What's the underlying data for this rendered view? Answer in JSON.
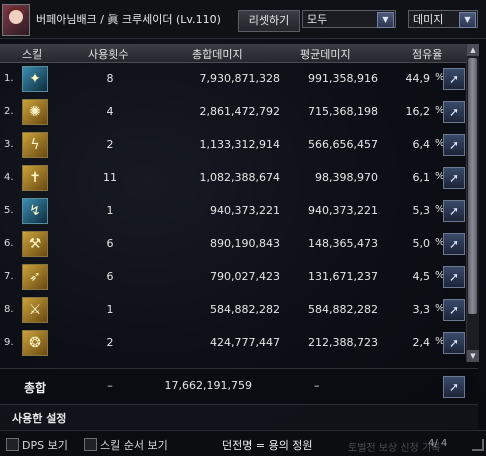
{
  "header": {
    "char_name": "버페아님배크 / 眞 크루세이더 (Lv.110)",
    "reset_label": "리셋하기",
    "filter_value": "모두",
    "metric_value": "데미지"
  },
  "columns": {
    "skill": "스킬",
    "uses": "사용횟수",
    "total": "총합데미지",
    "avg": "평균데미지",
    "share": "점유율"
  },
  "rows": [
    {
      "rank": "1.",
      "icon": "holy-light-skill-icon",
      "glyph": "✦",
      "color": "blue",
      "uses": "8",
      "total": "7,930,871,328",
      "avg": "991,358,916",
      "share": "44,9"
    },
    {
      "rank": "2.",
      "icon": "holy-wheel-skill-icon",
      "glyph": "✺",
      "color": "gold",
      "uses": "4",
      "total": "2,861,472,792",
      "avg": "715,368,198",
      "share": "16,2"
    },
    {
      "rank": "3.",
      "icon": "thunder-strike-skill-icon",
      "glyph": "ϟ",
      "color": "gold",
      "uses": "2",
      "total": "1,133,312,914",
      "avg": "566,656,457",
      "share": "6,4"
    },
    {
      "rank": "4.",
      "icon": "cross-blessing-skill-icon",
      "glyph": "✝",
      "color": "gold",
      "uses": "11",
      "total": "1,082,388,674",
      "avg": "98,398,970",
      "share": "6,1"
    },
    {
      "rank": "5.",
      "icon": "lightning-bolt-skill-icon",
      "glyph": "↯",
      "color": "blue",
      "uses": "1",
      "total": "940,373,221",
      "avg": "940,373,221",
      "share": "5,3"
    },
    {
      "rank": "6.",
      "icon": "radiant-hammer-skill-icon",
      "glyph": "⚒",
      "color": "gold",
      "uses": "6",
      "total": "890,190,843",
      "avg": "148,365,473",
      "share": "5,0"
    },
    {
      "rank": "7.",
      "icon": "divine-arrow-skill-icon",
      "glyph": "➶",
      "color": "gold",
      "uses": "6",
      "total": "790,027,423",
      "avg": "131,671,237",
      "share": "4,5"
    },
    {
      "rank": "8.",
      "icon": "sacred-sword-skill-icon",
      "glyph": "⚔",
      "color": "gold",
      "uses": "1",
      "total": "584,882,282",
      "avg": "584,882,282",
      "share": "3,3"
    },
    {
      "rank": "9.",
      "icon": "spiral-light-skill-icon",
      "glyph": "❂",
      "color": "gold",
      "uses": "2",
      "total": "424,777,447",
      "avg": "212,388,723",
      "share": "2,4"
    }
  ],
  "percent_sign": "%",
  "total_row": {
    "label": "총합",
    "uses": "–",
    "total": "17,662,191,759",
    "avg": "–"
  },
  "settings_label": "사용한 설정",
  "bottom": {
    "dps_label": "DPS 보기",
    "skill_order_label": "스킬 순서 보기",
    "title_label": "던전명 = 용의 정원",
    "page": "4/ 4",
    "faint_text": "토벌전 보상 신청 기록"
  }
}
